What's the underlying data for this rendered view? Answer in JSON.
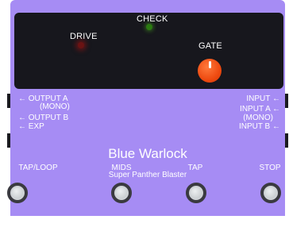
{
  "colors": {
    "pedal_body": "#a68cf4",
    "control_panel": "#17171d",
    "gate_knob": "#ee4a10",
    "drive_led": "#8c1a1a",
    "check_led": "#3a8a18",
    "text": "#ffffff"
  },
  "panel": {
    "drive_label": "DRIVE",
    "check_label": "CHECK",
    "gate_label": "GATE"
  },
  "io": {
    "left": {
      "output_a": "← OUTPUT A",
      "output_a_mono": "(MONO)",
      "output_b": "← OUTPUT B",
      "exp": "← EXP"
    },
    "right": {
      "input": "INPUT ←",
      "input_a": "INPUT A ←",
      "input_a_mono": "(MONO)",
      "input_b": "INPUT B ←"
    }
  },
  "pedal": {
    "name": "Blue Warlock",
    "subtitle": "Super Panther Blaster"
  },
  "footswitches": [
    {
      "label": "TAP/LOOP"
    },
    {
      "label": "MIDS"
    },
    {
      "label": "TAP"
    },
    {
      "label": "STOP"
    }
  ],
  "icons": {
    "arrow": "left-arrow-icon"
  }
}
